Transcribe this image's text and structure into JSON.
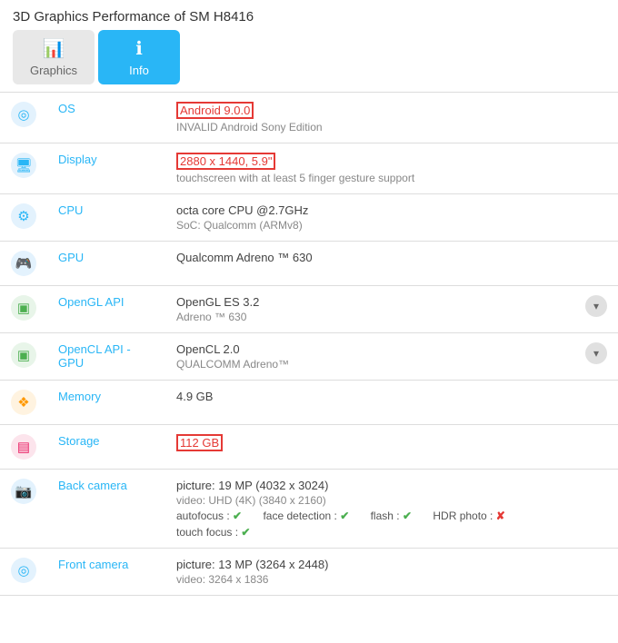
{
  "header": {
    "title": "3D Graphics Performance of SM H8416"
  },
  "tabs": [
    {
      "id": "graphics",
      "label": "Graphics",
      "icon": "📊",
      "active": false
    },
    {
      "id": "info",
      "label": "Info",
      "icon": "ℹ",
      "active": true
    }
  ],
  "rows": [
    {
      "id": "os",
      "icon": "⚙",
      "iconClass": "icon-os",
      "label": "OS",
      "value": "Android 9.0.0",
      "valueHighlighted": true,
      "subValue": "INVALID Android Sony Edition",
      "hasDropdown": false
    },
    {
      "id": "display",
      "icon": "🖥",
      "iconClass": "icon-display",
      "label": "Display",
      "value": "2880 x 1440, 5.9\"",
      "valueHighlighted": true,
      "subValue": "touchscreen with at least 5 finger gesture support",
      "hasDropdown": false
    },
    {
      "id": "cpu",
      "icon": "⚡",
      "iconClass": "icon-cpu",
      "label": "CPU",
      "value": "octa core CPU @2.7GHz",
      "valueHighlighted": false,
      "subValue": "SoC: Qualcomm (ARMv8)",
      "hasDropdown": false
    },
    {
      "id": "gpu",
      "icon": "🎮",
      "iconClass": "icon-gpu",
      "label": "GPU",
      "value": "Qualcomm Adreno ™ 630",
      "valueHighlighted": false,
      "subValue": "",
      "hasDropdown": false
    },
    {
      "id": "opengl",
      "icon": "🟩",
      "iconClass": "icon-opengl",
      "label": "OpenGL API",
      "value": "OpenGL ES 3.2",
      "valueHighlighted": false,
      "subValue": "Adreno ™ 630",
      "hasDropdown": true
    },
    {
      "id": "opencl",
      "icon": "🟩",
      "iconClass": "icon-opencl",
      "label": "OpenCL API - GPU",
      "value": "OpenCL 2.0",
      "valueHighlighted": false,
      "subValue": "QUALCOMM Adreno™",
      "hasDropdown": true
    },
    {
      "id": "memory",
      "icon": "💾",
      "iconClass": "icon-memory",
      "label": "Memory",
      "value": "4.9 GB",
      "valueHighlighted": false,
      "subValue": "",
      "hasDropdown": false
    },
    {
      "id": "storage",
      "icon": "📦",
      "iconClass": "icon-storage",
      "label": "Storage",
      "value": "112 GB",
      "valueHighlighted": true,
      "subValue": "",
      "hasDropdown": false
    },
    {
      "id": "backcam",
      "icon": "📷",
      "iconClass": "icon-backcam",
      "label": "Back camera",
      "value": "picture: 19 MP (4032 x 3024)",
      "valueHighlighted": false,
      "subValue": "video: UHD (4K) (3840 x 2160)",
      "features": {
        "autofocus": true,
        "face_detection": true,
        "flash": true,
        "hdr_photo": false,
        "touch_focus": true
      },
      "hasDropdown": false
    },
    {
      "id": "frontcam",
      "icon": "🤳",
      "iconClass": "icon-frontcam",
      "label": "Front camera",
      "value": "picture: 13 MP (3264 x 2448)",
      "valueHighlighted": false,
      "subValue": "video: 3264 x 1836",
      "hasDropdown": false
    }
  ],
  "labels": {
    "autofocus": "autofocus :",
    "face_detection": "face detection :",
    "flash": "flash :",
    "hdr_photo": "HDR photo :",
    "touch_focus": "touch focus :"
  }
}
